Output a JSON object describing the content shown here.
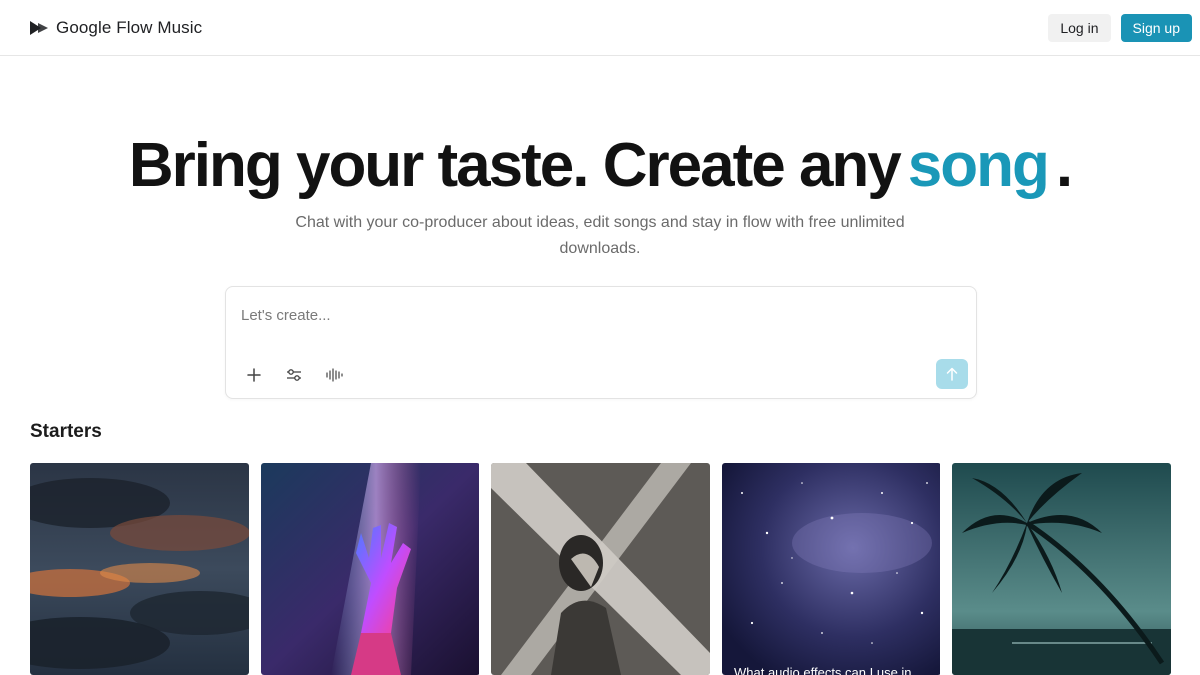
{
  "header": {
    "brand_name": "Google Flow Music",
    "login_label": "Log in",
    "signup_label": "Sign up",
    "accent_color": "#1a93b5"
  },
  "hero": {
    "title_part1": "Bring your taste. Create any",
    "title_accent": "song",
    "title_end": ".",
    "subtitle": "Chat with your co-producer about ideas, edit songs and stay in flow with free unlimited downloads."
  },
  "prompt": {
    "placeholder": "Let's create...",
    "tools": [
      "plus-icon",
      "sliders-icon",
      "waveform-icon"
    ],
    "send_icon": "arrow-up-icon"
  },
  "starters": {
    "title": "Starters",
    "cards": [
      {
        "image": "sunset-clouds",
        "caption": ""
      },
      {
        "image": "neon-hand",
        "caption": ""
      },
      {
        "image": "woman-light-beam",
        "caption": ""
      },
      {
        "image": "starry-sky",
        "caption": "What audio effects can I use in"
      },
      {
        "image": "palm-tree-sea",
        "caption": ""
      }
    ]
  }
}
